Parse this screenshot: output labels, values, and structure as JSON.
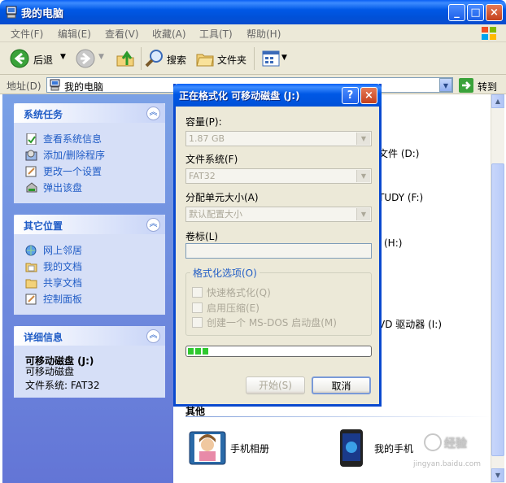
{
  "window": {
    "title": "我的电脑",
    "controls": {
      "minimize": "_",
      "maximize": "□",
      "close": "×"
    }
  },
  "menu": [
    "文件(F)",
    "编辑(E)",
    "查看(V)",
    "收藏(A)",
    "工具(T)",
    "帮助(H)"
  ],
  "toolbar": {
    "back": "后退",
    "search": "搜索",
    "folders": "文件夹"
  },
  "address": {
    "label": "地址(D)",
    "value": "我的电脑",
    "go": "转到"
  },
  "sidebar": {
    "system_tasks": {
      "title": "系统任务",
      "items": [
        "查看系统信息",
        "添加/删除程序",
        "更改一个设置",
        "弹出该盘"
      ]
    },
    "other_places": {
      "title": "其它位置",
      "items": [
        "网上邻居",
        "我的文档",
        "共享文档",
        "控制面板"
      ]
    },
    "details": {
      "title": "详细信息",
      "name": "可移动磁盘 (J:)",
      "type": "可移动磁盘",
      "fs": "文件系统: FAT32"
    }
  },
  "content": {
    "frag_d": "文件 (D:)",
    "frag_f": "TUDY (F:)",
    "frag_h": "(H:)",
    "frag_i": "VD 驱动器 (I:)",
    "section_other": "其他",
    "item_album": "手机相册",
    "item_phone": "我的手机"
  },
  "dialog": {
    "title": "正在格式化 可移动磁盘 (J:)",
    "help": "?",
    "close": "×",
    "capacity_label": "容量(P):",
    "capacity_value": "1.87 GB",
    "fs_label": "文件系统(F)",
    "fs_value": "FAT32",
    "alloc_label": "分配单元大小(A)",
    "alloc_value": "默认配置大小",
    "volume_label": "卷标(L)",
    "volume_value": "",
    "options_label": "格式化选项(O)",
    "options": [
      "快速格式化(Q)",
      "启用压缩(E)",
      "创建一个 MS-DOS 启动盘(M)"
    ],
    "progress": 0.12,
    "start": "开始(S)",
    "cancel": "取消"
  },
  "watermark": {
    "site": "jingyan.baidu.com"
  }
}
